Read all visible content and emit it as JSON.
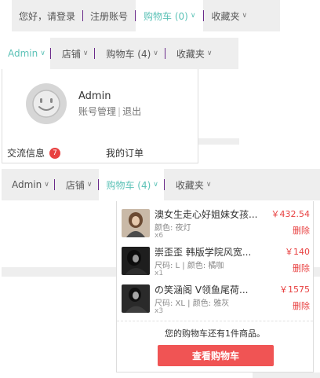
{
  "bar1": {
    "items": [
      {
        "label": "您好，请登录"
      },
      {
        "label": "注册账号"
      },
      {
        "label": "购物车 (0)"
      },
      {
        "label": "收藏夹"
      }
    ]
  },
  "bar2": {
    "items": [
      {
        "label": "Admin"
      },
      {
        "label": "店铺"
      },
      {
        "label": "购物车 (4)"
      },
      {
        "label": "收藏夹"
      }
    ]
  },
  "account_panel": {
    "username": "Admin",
    "manage_link": "账号管理",
    "logout_link": "退出",
    "messages_label": "交流信息",
    "messages_count": "7",
    "orders_label": "我的订单"
  },
  "bar3": {
    "items": [
      {
        "label": "Admin"
      },
      {
        "label": "店铺"
      },
      {
        "label": "购物车 (4)"
      },
      {
        "label": "收藏夹"
      }
    ]
  },
  "cart_panel": {
    "items": [
      {
        "title": "澳女生走心好姐妹女孩...",
        "spec": "颜色: 夜灯",
        "qty": "x6",
        "price": "￥432.54",
        "delete": "删除",
        "thumb_color": "#6b5a4a"
      },
      {
        "title": "崇歪歪 韩版学院风宽...",
        "spec": "尺码: L | 颜色: 橘咖",
        "qty": "x1",
        "price": "￥140",
        "delete": "删除",
        "thumb_color": "#2a2a2a"
      },
      {
        "title": "の笑涵阁 V领鱼尾荷...",
        "spec": "尺码: XL | 颜色: 雅灰",
        "qty": "x3",
        "price": "￥1575",
        "delete": "删除",
        "thumb_color": "#3a3a3a"
      }
    ],
    "summary": "您的购物车还有1件商品。",
    "checkout": "查看购物车"
  },
  "colors": {
    "accent": "#5cc2b7",
    "price_red": "#e84040",
    "checkout_bg": "#f05454",
    "bar_bg": "#eeeeee",
    "separator": "#6a2a8a"
  },
  "icons": {
    "chevron": "chevron-down-icon",
    "avatar": "user-avatar-icon"
  }
}
